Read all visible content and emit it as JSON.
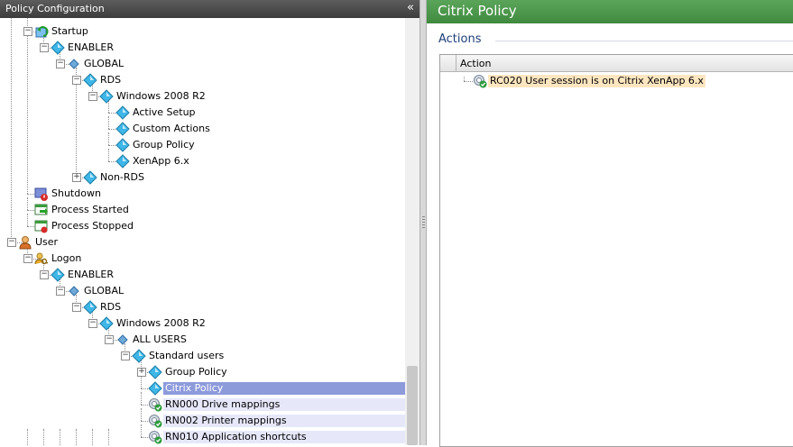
{
  "left_panel": {
    "title": "Policy Configuration",
    "collapse_glyph": "«"
  },
  "right_panel": {
    "title": "Citrix Policy",
    "section_title": "Actions",
    "grid": {
      "column_header": "Action",
      "rows": [
        {
          "label": "RC020 User session is on Citrix XenApp 6.x",
          "icon": "script-icon"
        }
      ]
    }
  },
  "tree": [
    {
      "label": "Startup",
      "icon": "startup-icon",
      "level": 2,
      "expander": "-"
    },
    {
      "label": "ENABLER",
      "icon": "diamond-icon",
      "level": 3,
      "expander": "-"
    },
    {
      "label": "GLOBAL",
      "icon": "small-diamond-icon",
      "level": 4,
      "expander": "-"
    },
    {
      "label": "RDS",
      "icon": "diamond-icon",
      "level": 5,
      "expander": "-"
    },
    {
      "label": "Windows 2008 R2",
      "icon": "diamond-icon",
      "level": 6,
      "expander": "-"
    },
    {
      "label": "Active Setup",
      "icon": "diamond-icon",
      "level": 7,
      "expander": ""
    },
    {
      "label": "Custom Actions",
      "icon": "diamond-icon",
      "level": 7,
      "expander": ""
    },
    {
      "label": "Group Policy",
      "icon": "diamond-icon",
      "level": 7,
      "expander": ""
    },
    {
      "label": "XenApp 6.x",
      "icon": "diamond-icon",
      "level": 7,
      "expander": ""
    },
    {
      "label": "Non-RDS",
      "icon": "diamond-icon",
      "level": 5,
      "expander": "+"
    },
    {
      "label": "Shutdown",
      "icon": "shutdown-icon",
      "level": 2,
      "expander": ""
    },
    {
      "label": "Process Started",
      "icon": "process-started-icon",
      "level": 2,
      "expander": ""
    },
    {
      "label": "Process Stopped",
      "icon": "process-stopped-icon",
      "level": 2,
      "expander": ""
    },
    {
      "label": "User",
      "icon": "user-icon",
      "level": 1,
      "expander": "-"
    },
    {
      "label": "Logon",
      "icon": "logon-icon",
      "level": 2,
      "expander": "-"
    },
    {
      "label": "ENABLER",
      "icon": "diamond-icon",
      "level": 3,
      "expander": "-"
    },
    {
      "label": "GLOBAL",
      "icon": "small-diamond-icon",
      "level": 4,
      "expander": "-"
    },
    {
      "label": "RDS",
      "icon": "diamond-icon",
      "level": 5,
      "expander": "-"
    },
    {
      "label": "Windows 2008 R2",
      "icon": "diamond-icon",
      "level": 6,
      "expander": "-"
    },
    {
      "label": "ALL USERS",
      "icon": "small-diamond-icon",
      "level": 7,
      "expander": "-"
    },
    {
      "label": "Standard users",
      "icon": "diamond-icon",
      "level": 8,
      "expander": "-"
    },
    {
      "label": "Group Policy",
      "icon": "diamond-icon",
      "level": 9,
      "expander": "+"
    },
    {
      "label": "Citrix Policy",
      "icon": "diamond-icon",
      "level": 9,
      "expander": "",
      "selected": true
    },
    {
      "label": "RN000 Drive mappings",
      "icon": "script-icon",
      "level": 9,
      "expander": "",
      "highlight": true
    },
    {
      "label": "RN002 Printer mappings",
      "icon": "script-icon",
      "level": 9,
      "expander": "",
      "highlight": true
    },
    {
      "label": "RN010 Application shortcuts",
      "icon": "script-icon",
      "level": 9,
      "expander": "",
      "highlight": true
    }
  ],
  "colors": {
    "left_header": "#4a4a4a",
    "right_header": "#4b984b",
    "selection": "#8d9bdb",
    "row_highlight": "#e6e8fa",
    "action_row": "#fde6c0",
    "diamond": "#3fb6e8"
  }
}
